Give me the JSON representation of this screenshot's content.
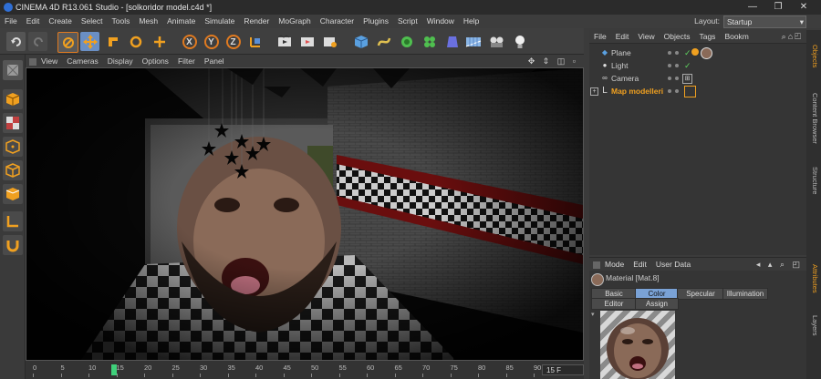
{
  "window": {
    "title": "CINEMA 4D R13.061 Studio - [solkoridor model.c4d *]",
    "controls": [
      "—",
      "❐",
      "✕"
    ]
  },
  "menubar": {
    "items": [
      "File",
      "Edit",
      "Create",
      "Select",
      "Tools",
      "Mesh",
      "Animate",
      "Simulate",
      "Render",
      "MoGraph",
      "Character",
      "Plugins",
      "Script",
      "Window",
      "Help"
    ],
    "layout_label": "Layout:",
    "layout_value": "Startup"
  },
  "toolbar": {
    "axis_x": "X",
    "axis_y": "Y",
    "axis_z": "Z"
  },
  "viewport": {
    "menu": [
      "View",
      "Cameras",
      "Display",
      "Options",
      "Filter",
      "Panel"
    ]
  },
  "timeline": {
    "ticks": [
      "0",
      "5",
      "10",
      "15",
      "20",
      "25",
      "30",
      "35",
      "40",
      "45",
      "50",
      "55",
      "60",
      "65",
      "70",
      "75",
      "80",
      "85",
      "90"
    ],
    "current_frame": 15,
    "frame_field": "15 F"
  },
  "object_manager": {
    "menu": [
      "File",
      "Edit",
      "View",
      "Objects",
      "Tags",
      "Bookm"
    ],
    "objects": [
      {
        "name": "Plane",
        "icon": "plane-icon"
      },
      {
        "name": "Light",
        "icon": "light-icon"
      },
      {
        "name": "Camera",
        "icon": "camera-icon"
      },
      {
        "name": "Map modelleri",
        "icon": "null-icon"
      }
    ]
  },
  "side_tabs": [
    "Objects",
    "Content Browser",
    "Structure",
    "Attributes",
    "Layers"
  ],
  "attributes": {
    "menu": [
      "Mode",
      "Edit",
      "User Data"
    ],
    "material_label": "Material [Mat.8]",
    "tabs_row1": [
      "Basic",
      "Color",
      "Specular",
      "Illumination"
    ],
    "tabs_row2": [
      "Editor",
      "Assign"
    ],
    "active_tab": "Color"
  },
  "colors": {
    "accent": "#f0a020",
    "selected_object": "#f0a020",
    "active_tab": "#7aa2d6"
  }
}
